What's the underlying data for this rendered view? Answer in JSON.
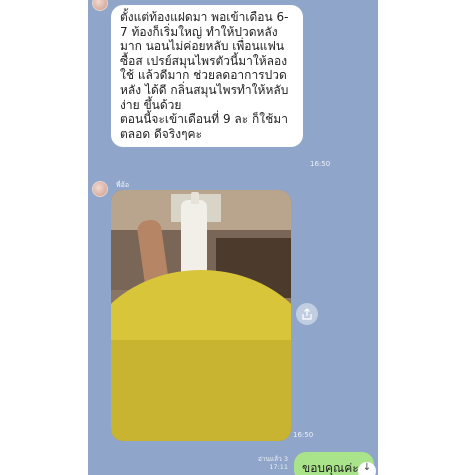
{
  "chat": {
    "message1": {
      "text": "ตั้งแต่ท้องแฝดมา พอเข้าเดือน 6-7 ท้องก็เริ่มใหญ่ ทำให้ปวดหลังมาก นอนไม่ค่อยหลับ เพื่อนแฟนซื้อส เปรย์สมุนไพรตัวนี้มาให้ลอง ใช้ แล้วดีมาก ช่วยลดอาการปวดหลัง ได้ดี กลิ่นสมุนไพรทำให้หลับง่าย ขึ้นด้วย\nตอนนี้จะเข้าเดือนที่ 9 ละ ก็ใช้มา ตลอด ดีจริงๆคะ",
      "time": "16:50"
    },
    "sender_name": "พี่อ้อ",
    "photo_message": {
      "time": "16:50"
    },
    "reply": {
      "text": "ขอบคุณค่ะ",
      "read_status": "อ่านแล้ว 3",
      "time": "17:11"
    }
  },
  "colors": {
    "chat_background": "#8fa5c9",
    "incoming_bubble": "#ffffff",
    "outgoing_bubble": "#a9e38a"
  },
  "icons": {
    "share": "share-icon",
    "scroll_down": "arrow-down-icon"
  }
}
